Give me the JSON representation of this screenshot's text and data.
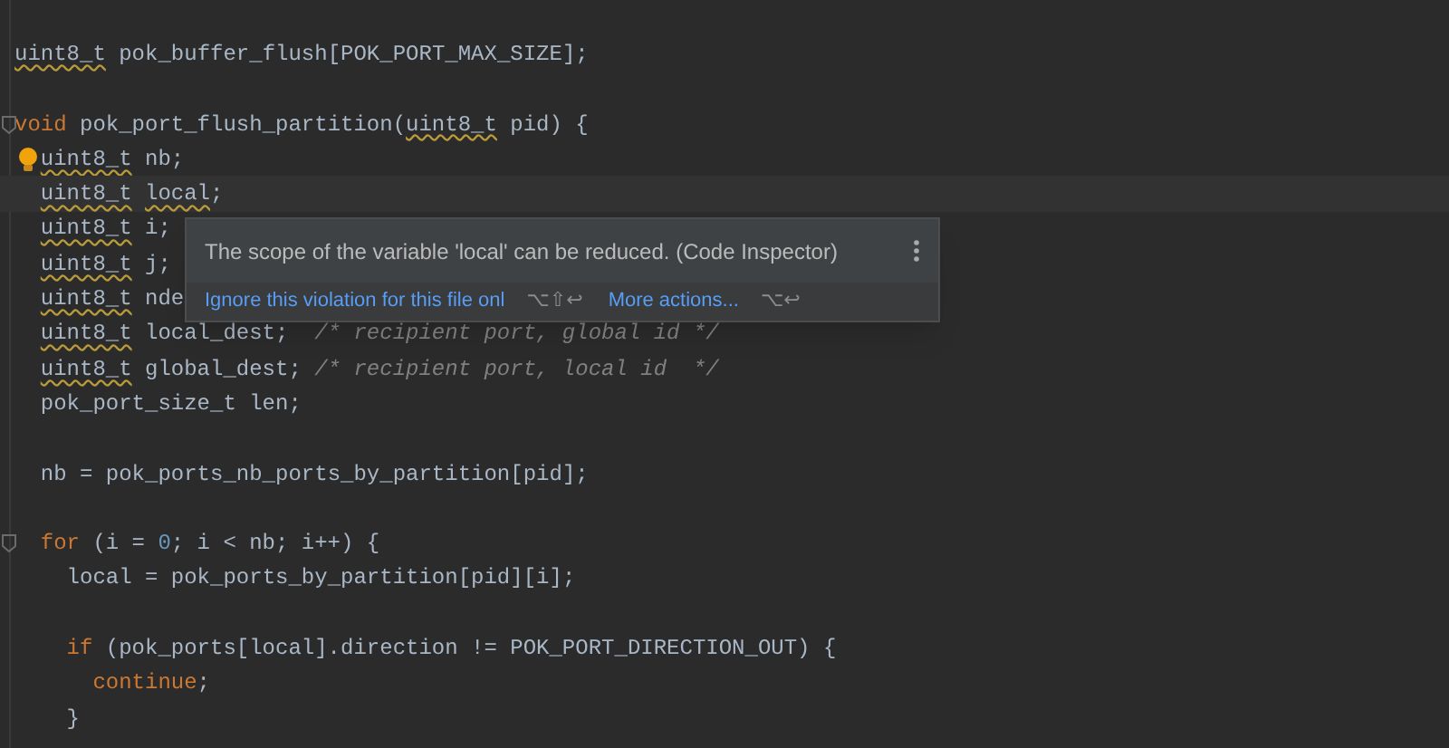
{
  "editor": {
    "lines": [
      {
        "kind": "blank"
      },
      {
        "kind": "code",
        "tokens": [
          {
            "kind": "warn",
            "text": "uint8_t"
          },
          {
            "kind": "plain",
            "text": "pok_buffer_flush[POK_PORT_MAX_SIZE];",
            "spaced": true
          }
        ]
      },
      {
        "kind": "blank"
      },
      {
        "kind": "code",
        "fold": true,
        "tokens": [
          {
            "kind": "keyword",
            "text": "void"
          },
          {
            "kind": "plain",
            "text": "pok_port_flush_partition(",
            "spaced": true
          },
          {
            "kind": "warn",
            "text": "uint8_t"
          },
          {
            "kind": "plain",
            "text": "pid) {",
            "spaced": true
          }
        ],
        "children": [
          {
            "kind": "code",
            "bulb": true,
            "tokens": [
              {
                "kind": "warn",
                "text": "uint8_t"
              },
              {
                "kind": "plain",
                "text": "nb;",
                "spaced": true
              }
            ]
          },
          {
            "kind": "code",
            "current": true,
            "tokens": [
              {
                "kind": "warn",
                "text": "uint8_t"
              },
              {
                "kind": "warn",
                "text": "local",
                "spaced": true
              },
              {
                "kind": "plain",
                "text": ";"
              }
            ]
          },
          {
            "kind": "code",
            "tokens": [
              {
                "kind": "warn",
                "text": "uint8_t"
              },
              {
                "kind": "plain",
                "text": "i;",
                "spaced": true
              }
            ]
          },
          {
            "kind": "code",
            "tokens": [
              {
                "kind": "warn",
                "text": "uint8_t"
              },
              {
                "kind": "plain",
                "text": "j;",
                "spaced": true
              }
            ]
          },
          {
            "kind": "code",
            "tokens": [
              {
                "kind": "warn",
                "text": "uint8_t"
              },
              {
                "kind": "plain",
                "text": "nde",
                "spaced": true
              }
            ]
          },
          {
            "kind": "code",
            "tokens": [
              {
                "kind": "warn",
                "text": "uint8_t"
              },
              {
                "kind": "plain",
                "text": "local_dest;",
                "spaced": true
              },
              {
                "kind": "comment",
                "text": "/* recipient port, global id */",
                "spaced": true,
                "wide": true
              }
            ]
          },
          {
            "kind": "code",
            "tokens": [
              {
                "kind": "warn",
                "text": "uint8_t"
              },
              {
                "kind": "plain",
                "text": "global_dest;",
                "spaced": true
              },
              {
                "kind": "comment",
                "text": "/* recipient port, local id  */",
                "spaced": true
              }
            ]
          },
          {
            "kind": "code",
            "tokens": [
              {
                "kind": "plain",
                "text": "pok_port_size_t len;"
              }
            ]
          },
          {
            "kind": "blank"
          },
          {
            "kind": "code",
            "tokens": [
              {
                "kind": "plain",
                "text": "nb = pok_ports_nb_ports_by_partition[pid];"
              }
            ]
          },
          {
            "kind": "blank"
          },
          {
            "kind": "code",
            "fold": true,
            "tokens": [
              {
                "kind": "keyword",
                "text": "for"
              },
              {
                "kind": "plain",
                "text": "(i =",
                "spaced": true
              },
              {
                "kind": "number",
                "text": "0",
                "spaced": true
              },
              {
                "kind": "plain",
                "text": "; i < nb; i++) {"
              }
            ],
            "children": [
              {
                "kind": "code",
                "tokens": [
                  {
                    "kind": "plain",
                    "text": "local = pok_ports_by_partition[pid][i];"
                  }
                ]
              },
              {
                "kind": "blank"
              },
              {
                "kind": "code",
                "tokens": [
                  {
                    "kind": "keyword",
                    "text": "if"
                  },
                  {
                    "kind": "plain",
                    "text": "(pok_ports[local].direction != POK_PORT_DIRECTION_OUT) {",
                    "spaced": true
                  }
                ],
                "children": [
                  {
                    "kind": "code",
                    "tokens": [
                      {
                        "kind": "keyword",
                        "text": "continue"
                      },
                      {
                        "kind": "plain",
                        "text": ";"
                      }
                    ]
                  }
                ]
              },
              {
                "kind": "code",
                "tokens": [
                  {
                    "kind": "plain",
                    "text": "}"
                  }
                ]
              }
            ]
          }
        ]
      }
    ]
  },
  "popup": {
    "message": "The scope of the variable 'local' can be reduced. (Code Inspector)",
    "actions": [
      {
        "label": "Ignore this violation for this file onl",
        "shortcut": "⌥⇧↩"
      },
      {
        "label": "More actions...",
        "shortcut": "⌥↩"
      }
    ]
  }
}
